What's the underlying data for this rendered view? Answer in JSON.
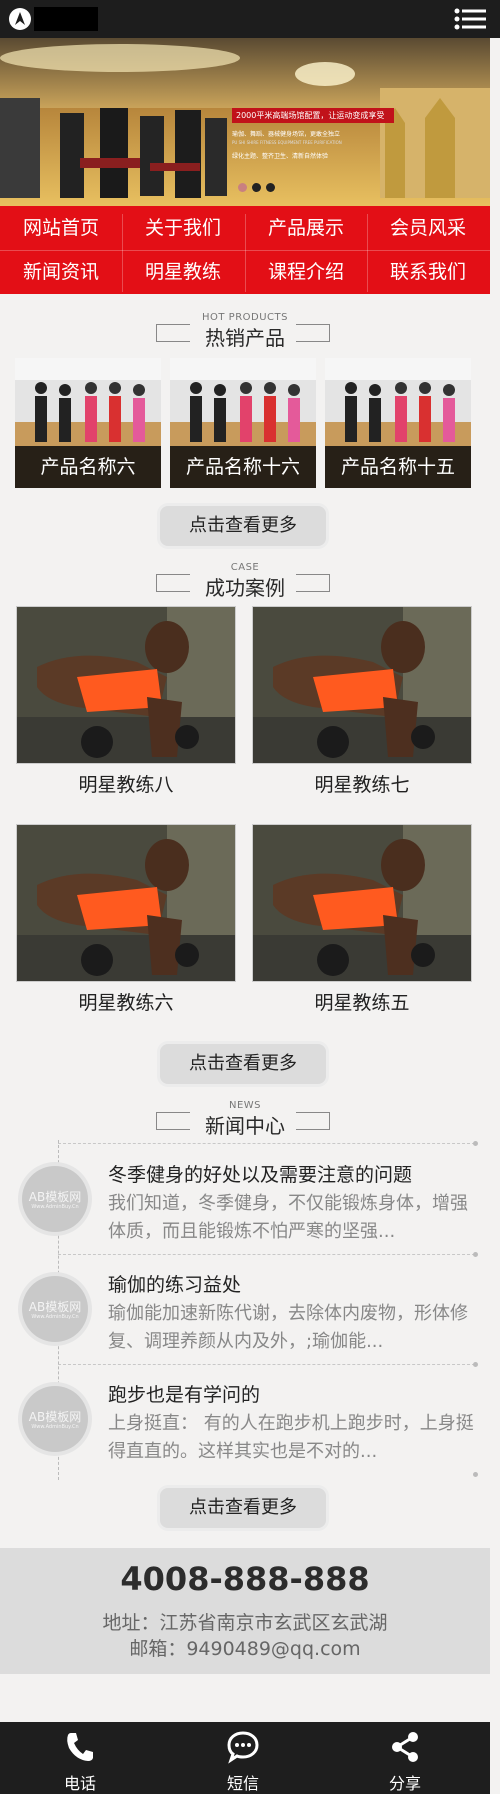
{
  "header": {
    "menu_icon": "hamburger-menu-icon",
    "logo_icon": "compass-logo-icon"
  },
  "banner": {
    "caption_title": "2000平米高端场馆配置，让运动变成享受",
    "caption_line1": "瑜伽、舞蹈、器械健身场馆，更敢全独立",
    "caption_line2": "PU SHI SHIRE  FITNESS EQUIPMENT  FREE PURIFICATION",
    "caption_line3": "绿化主题、整齐卫生、清新自然体验"
  },
  "nav": {
    "items": [
      "网站首页",
      "关于我们",
      "产品展示",
      "会员风采",
      "新闻资讯",
      "明星教练",
      "课程介绍",
      "联系我们"
    ]
  },
  "hot_products": {
    "en": "HOT PRODUCTS",
    "cn": "热销产品",
    "items": [
      "产品名称六",
      "产品名称十六",
      "产品名称十五"
    ],
    "more": "点击查看更多"
  },
  "cases": {
    "en": "CASE",
    "cn": "成功案例",
    "items": [
      "明星教练八",
      "明星教练七",
      "明星教练六",
      "明星教练五"
    ],
    "more": "点击查看更多"
  },
  "news": {
    "en": "NEWS",
    "cn": "新闻中心",
    "badge_main": "AB模板网",
    "badge_sub": "Www.AdminBuy.Cn",
    "items": [
      {
        "title": "冬季健身的好处以及需要注意的问题",
        "desc": "我们知道，冬季健身，不仅能锻炼身体，增强体质，而且能锻炼不怕严寒的坚强..."
      },
      {
        "title": "瑜伽的练习益处",
        "desc": "瑜伽能加速新陈代谢，去除体内废物，形体修复、调理养颜从内及外，;瑜伽能..."
      },
      {
        "title": "跑步也是有学问的",
        "desc": "上身挺直：  有的人在跑步机上跑步时，上身挺得直直的。这样其实也是不对的..."
      }
    ],
    "more": "点击查看更多"
  },
  "contact": {
    "phone": "4008-888-888",
    "address": "地址：江苏省南京市玄武区玄武湖",
    "email": "邮箱：9490489@qq.com"
  },
  "footer": {
    "items": [
      {
        "label": "电话",
        "icon": "phone-icon"
      },
      {
        "label": "短信",
        "icon": "chat-bubble-icon"
      },
      {
        "label": "分享",
        "icon": "share-icon"
      }
    ]
  }
}
